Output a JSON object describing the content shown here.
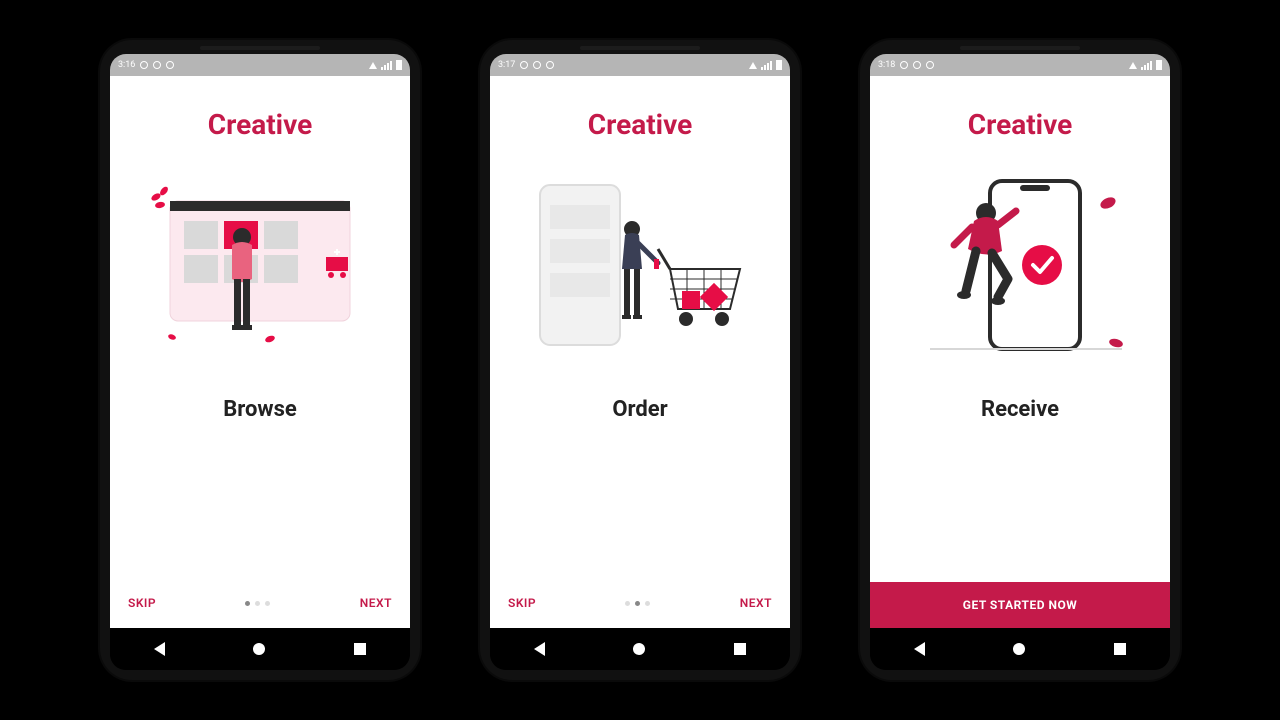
{
  "brand_color": "#c41a4a",
  "app_name": "Creative",
  "screens": [
    {
      "status_time": "3:16",
      "title": "Creative",
      "step_title": "Browse",
      "skip_label": "SKIP",
      "next_label": "NEXT",
      "page_index": 0,
      "page_count": 3
    },
    {
      "status_time": "3:17",
      "title": "Creative",
      "step_title": "Order",
      "skip_label": "SKIP",
      "next_label": "NEXT",
      "page_index": 1,
      "page_count": 3
    },
    {
      "status_time": "3:18",
      "title": "Creative",
      "step_title": "Receive",
      "cta_label": "GET STARTED NOW",
      "page_index": 2,
      "page_count": 3
    }
  ]
}
